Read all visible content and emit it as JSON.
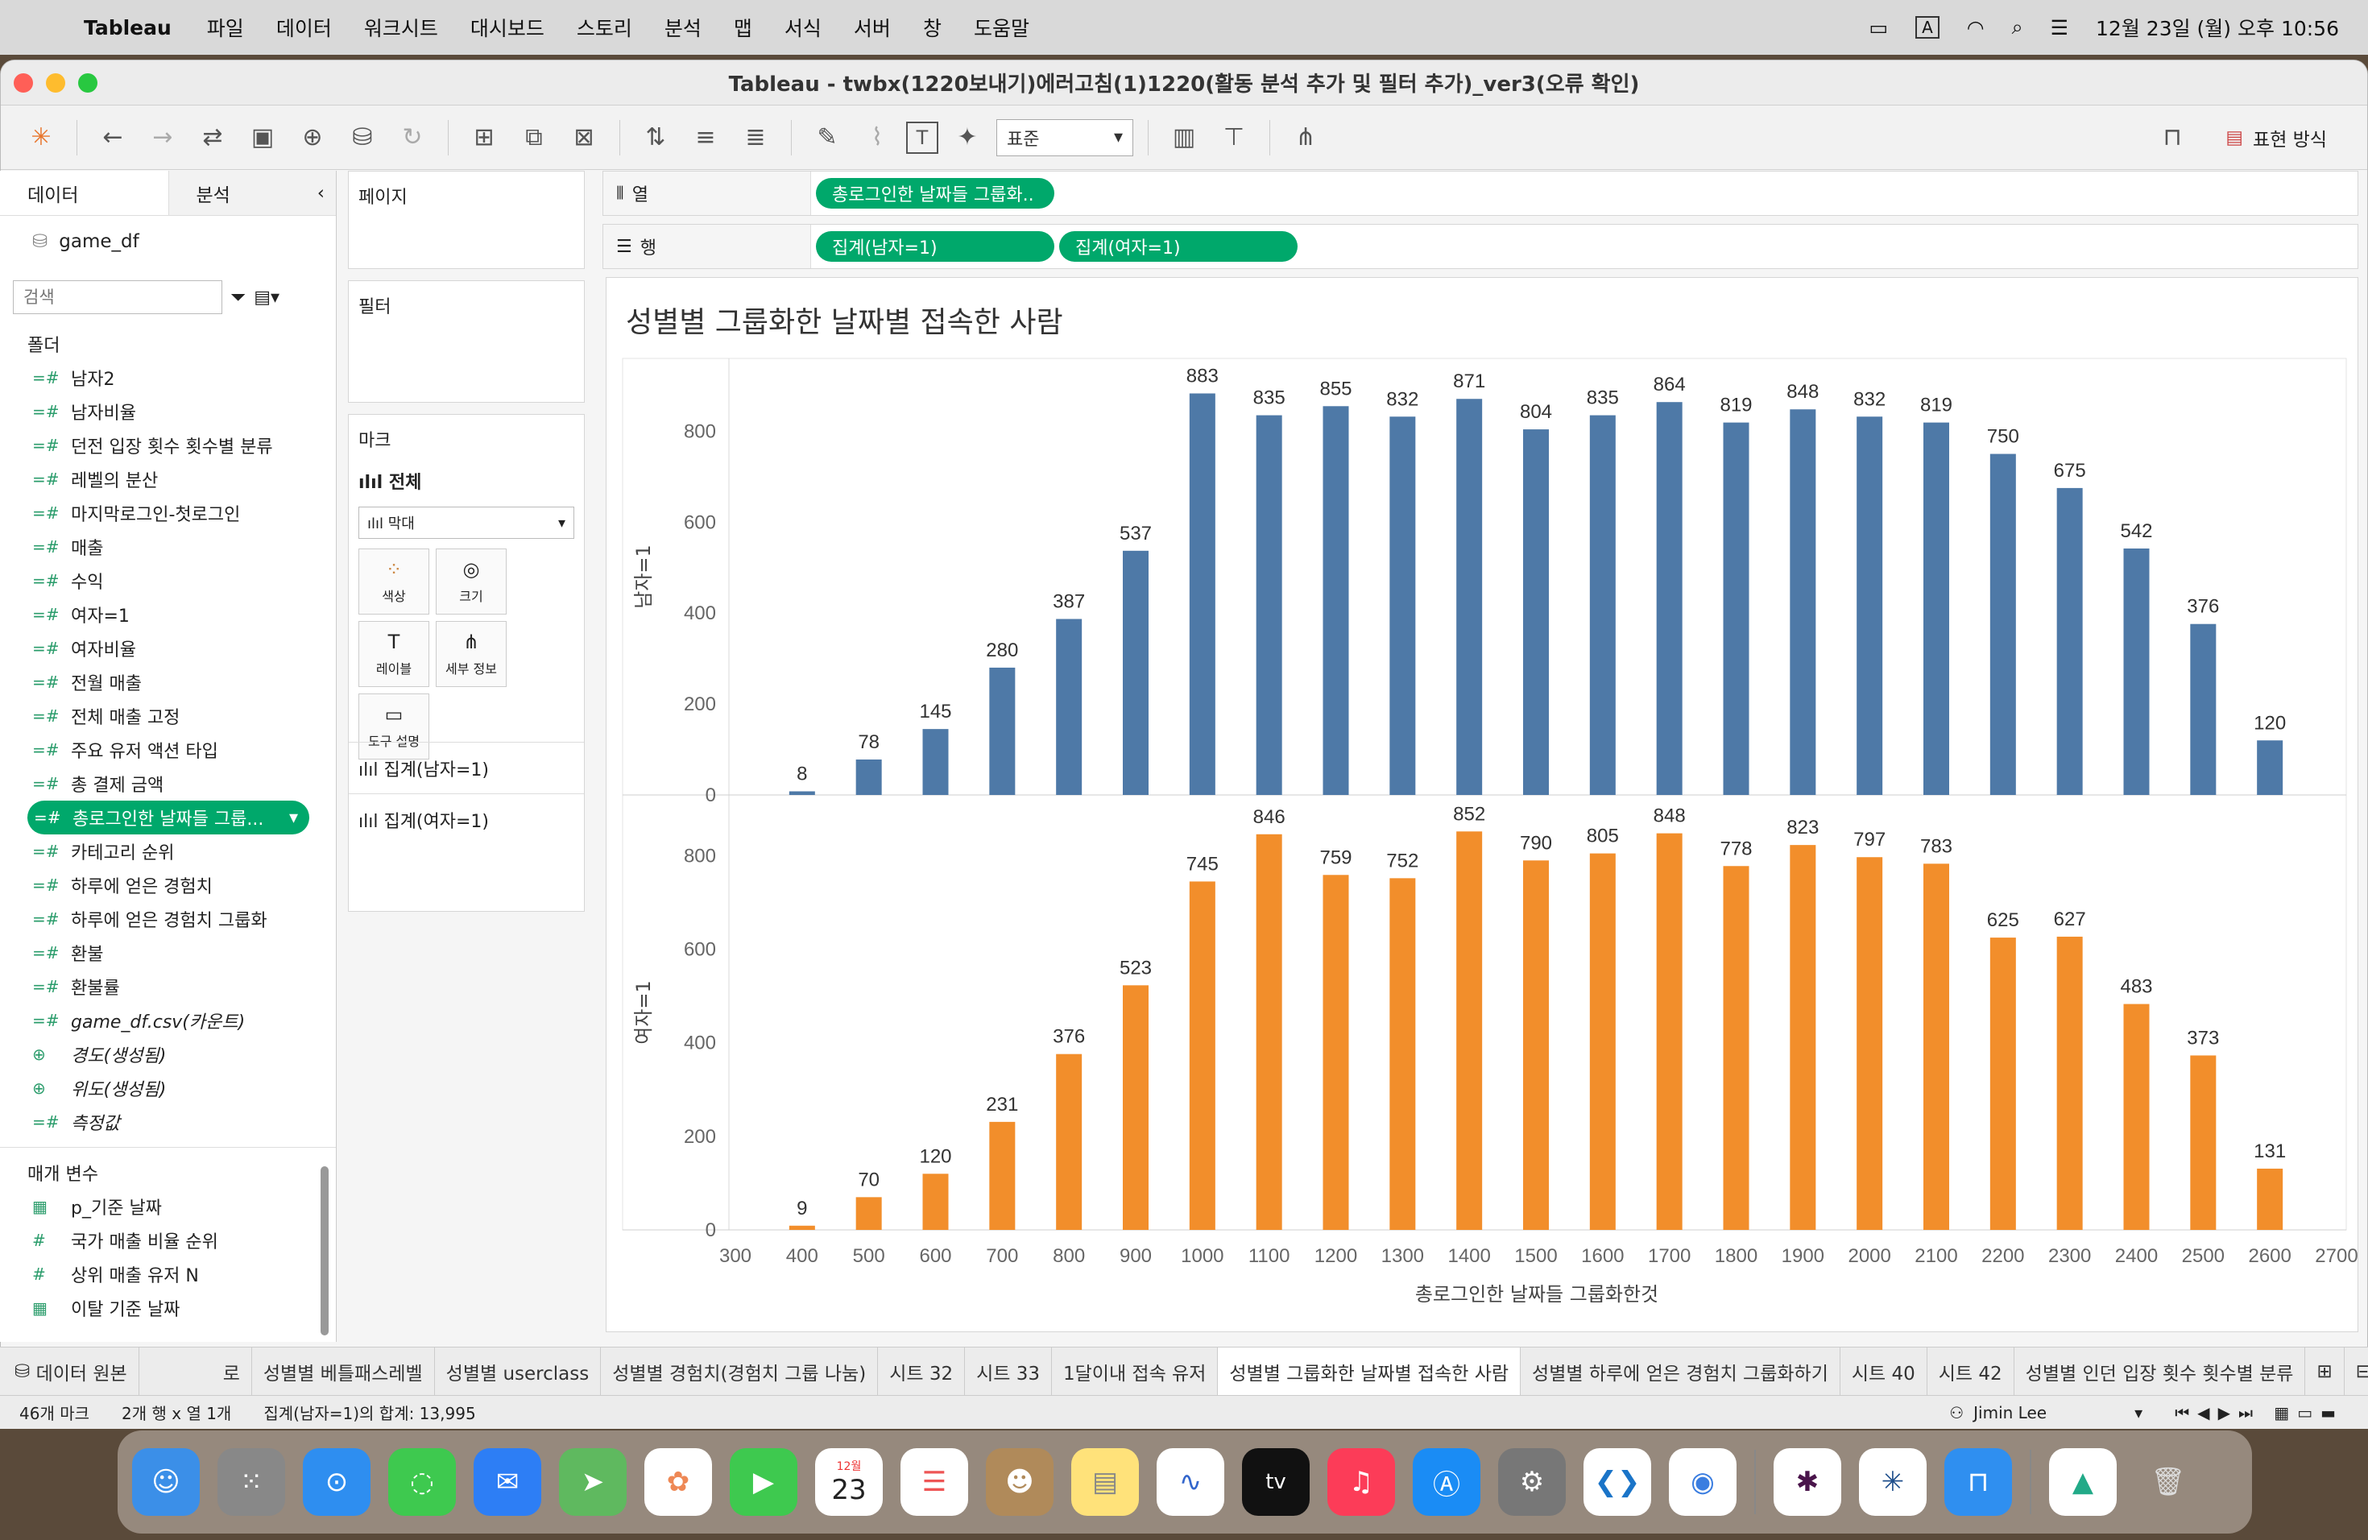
{
  "menubar": {
    "app": "Tableau",
    "items": [
      "파일",
      "데이터",
      "워크시트",
      "대시보드",
      "스토리",
      "분석",
      "맵",
      "서식",
      "서버",
      "창",
      "도움말"
    ],
    "input_indicator": "A",
    "clock": "12월 23일 (월) 오후 10:56"
  },
  "window": {
    "title": "Tableau - twbx(1220보내기)에러고침(1)1220(활동 분석 추가 및 필터 추가)_ver3(오류 확인)",
    "fit_select": "표준",
    "show_me": "표현 방식"
  },
  "leftpane": {
    "tab_data": "데이터",
    "tab_analysis": "분석",
    "datasource": "game_df",
    "search_placeholder": "검색",
    "folder_header": "폴더",
    "fields": [
      {
        "name": "남자2",
        "type": "#"
      },
      {
        "name": "남자비율",
        "type": "#"
      },
      {
        "name": "던전 입장 횟수 횟수별 분류",
        "type": "#"
      },
      {
        "name": "레벨의 분산",
        "type": "#"
      },
      {
        "name": "마지막로그인-첫로그인",
        "type": "#"
      },
      {
        "name": "매출",
        "type": "#"
      },
      {
        "name": "수익",
        "type": "#"
      },
      {
        "name": "여자=1",
        "type": "#"
      },
      {
        "name": "여자비율",
        "type": "#"
      },
      {
        "name": "전월 매출",
        "type": "#"
      },
      {
        "name": "전체 매출 고정",
        "type": "#"
      },
      {
        "name": "주요 유저 액션 타입",
        "type": "#"
      },
      {
        "name": "총 결제 금액",
        "type": "#"
      },
      {
        "name": "총로그인한 날짜들 그룹...",
        "type": "#"
      },
      {
        "name": "카테고리 순위",
        "type": "#"
      },
      {
        "name": "하루에 얻은 경험치",
        "type": "#"
      },
      {
        "name": "하루에 얻은 경험치 그룹화",
        "type": "#"
      },
      {
        "name": "환불",
        "type": "#"
      },
      {
        "name": "환불률",
        "type": "#"
      },
      {
        "name": "game_df.csv(카운트)",
        "type": "#"
      },
      {
        "name": "경도(생성됨)",
        "type": "globe"
      },
      {
        "name": "위도(생성됨)",
        "type": "globe"
      },
      {
        "name": "측정값",
        "type": "#"
      }
    ],
    "params_header": "매개 변수",
    "params": [
      "p_기준 날짜",
      "국가 매출 비율 순위",
      "상위 매출 유저 N",
      "이탈 기준 날짜"
    ]
  },
  "midpane": {
    "pages": "페이지",
    "filters": "필터",
    "marks": "마크",
    "marks_all": "전체",
    "mark_type": "막대",
    "buttons": [
      "색상",
      "크기",
      "레이블",
      "세부 정보",
      "도구 설명"
    ],
    "measure1": "집계(남자=1)",
    "measure2": "집계(여자=1)"
  },
  "shelves": {
    "columns_label": "열",
    "rows_label": "행",
    "columns_pill": "총로그인한 날짜들 그룹화..",
    "rows_pills": [
      "집계(남자=1)",
      "집계(여자=1)"
    ]
  },
  "chart_data": {
    "type": "bar",
    "title": "성별별 그룹화한 날짜별 접속한 사람",
    "xlabel": "총로그인한 날짜들 그룹화한것",
    "x_ticks": [
      300,
      400,
      500,
      600,
      700,
      800,
      900,
      1000,
      1100,
      1200,
      1300,
      1400,
      1500,
      1600,
      1700,
      1800,
      1900,
      2000,
      2100,
      2200,
      2300,
      2400,
      2500,
      2600,
      2700
    ],
    "x": [
      400,
      500,
      600,
      700,
      800,
      900,
      1000,
      1100,
      1200,
      1300,
      1400,
      1500,
      1600,
      1700,
      1800,
      1900,
      2000,
      2100,
      2200,
      2300,
      2400,
      2500,
      2600
    ],
    "series": [
      {
        "name": "남자=1",
        "color": "#4e79a7",
        "values": [
          8,
          78,
          145,
          280,
          387,
          537,
          883,
          835,
          855,
          832,
          871,
          804,
          835,
          864,
          819,
          848,
          832,
          819,
          750,
          675,
          542,
          376,
          120
        ],
        "ylim": [
          0,
          960
        ],
        "yticks": [
          0,
          200,
          400,
          600,
          800
        ]
      },
      {
        "name": "여자=1",
        "color": "#f28e2b",
        "values": [
          9,
          70,
          120,
          231,
          376,
          523,
          745,
          846,
          759,
          752,
          852,
          790,
          805,
          848,
          778,
          823,
          797,
          783,
          625,
          627,
          483,
          373,
          131
        ],
        "ylim": [
          0,
          930
        ],
        "yticks": [
          0,
          200,
          400,
          600,
          800
        ]
      }
    ]
  },
  "sheettabs": [
    "데이터 원본",
    "로",
    "성별별 베틀패스레벨",
    "성별별 userclass",
    "성별별 경험치(경험치 그룹 나눔)",
    "시트 32",
    "시트 33",
    "1달이내 접속 유저",
    "성별별 그룹화한 날짜별 접속한 사람",
    "성별별 하루에 얻은 경험치 그룹화하기",
    "시트 40",
    "시트 42",
    "성별별 인던 입장 횟수 횟수별 분류"
  ],
  "active_tab": "성별별 그룹화한 날짜별 접속한 사람",
  "status": {
    "marks": "46개 마크",
    "rows_cols": "2개 행 x 열 1개",
    "sum": "집계(남자=1)의 합계: 13,995",
    "user": "Jimin Lee"
  },
  "dock": {
    "calendar_month": "12월",
    "calendar_day": "23",
    "tv_label": "tv"
  }
}
